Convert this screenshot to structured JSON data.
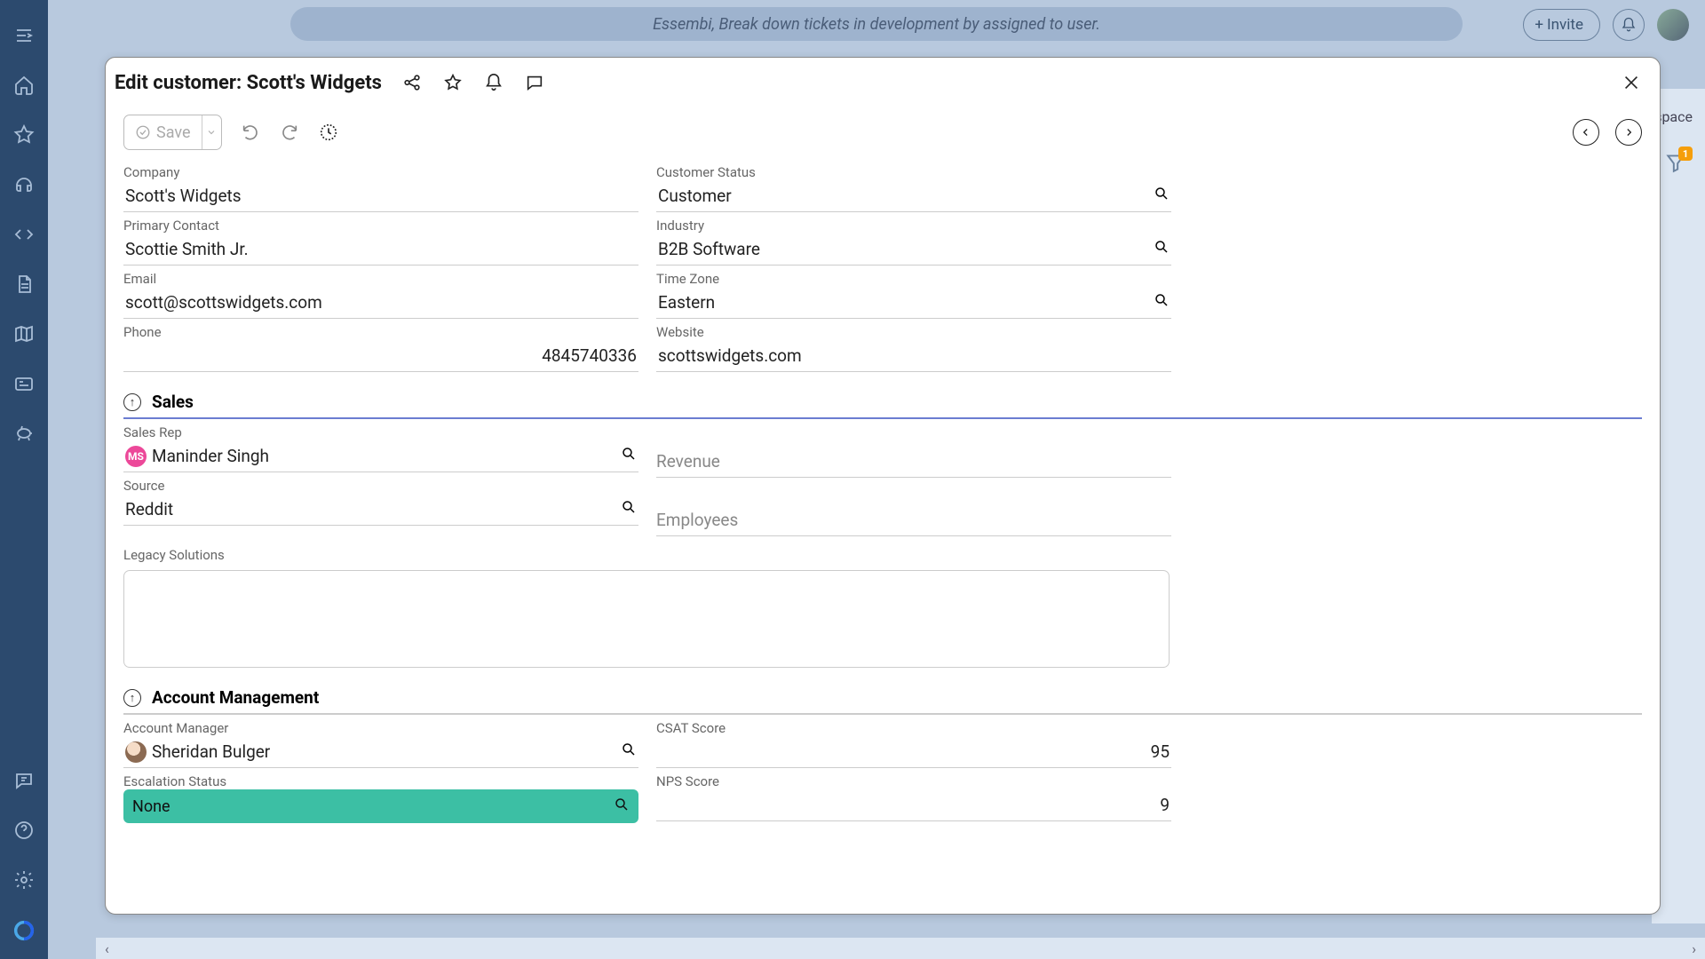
{
  "topbar": {
    "search_placeholder": "Essembi, Break down tickets in development by assigned to user.",
    "invite_label": "Invite"
  },
  "modal": {
    "title": "Edit customer: Scott's Widgets",
    "save_label": "Save"
  },
  "fields": {
    "company_label": "Company",
    "company_value": "Scott's Widgets",
    "primary_contact_label": "Primary Contact",
    "primary_contact_value": "Scottie Smith Jr.",
    "email_label": "Email",
    "email_value": "scott@scottswidgets.com",
    "phone_label": "Phone",
    "phone_value": "4845740336",
    "customer_status_label": "Customer Status",
    "customer_status_value": "Customer",
    "industry_label": "Industry",
    "industry_value": "B2B Software",
    "timezone_label": "Time Zone",
    "timezone_value": "Eastern",
    "website_label": "Website",
    "website_value": "scottswidgets.com"
  },
  "sections": {
    "sales_title": "Sales",
    "account_mgmt_title": "Account Management"
  },
  "sales": {
    "sales_rep_label": "Sales Rep",
    "sales_rep_value": "Maninder Singh",
    "sales_rep_initials": "MS",
    "source_label": "Source",
    "source_value": "Reddit",
    "legacy_label": "Legacy Solutions",
    "revenue_label": "Revenue",
    "employees_label": "Employees"
  },
  "account": {
    "manager_label": "Account Manager",
    "manager_value": "Sheridan Bulger",
    "escalation_label": "Escalation Status",
    "escalation_value": "None",
    "csat_label": "CSAT Score",
    "csat_value": "95",
    "nps_label": "NPS Score",
    "nps_value": "9"
  },
  "bg": {
    "space_label": "space",
    "badge_count": "1"
  }
}
